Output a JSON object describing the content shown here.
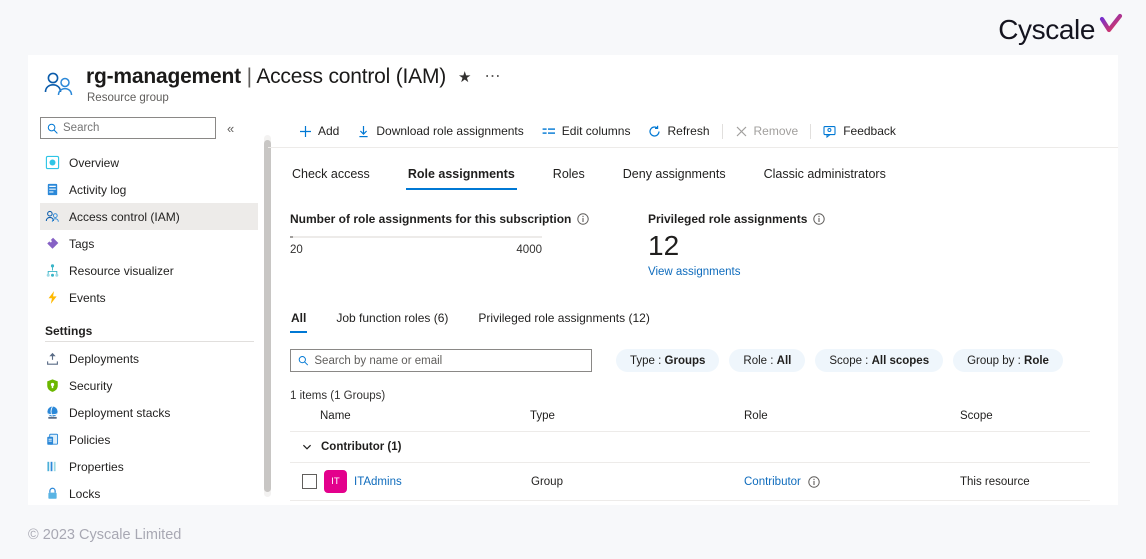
{
  "brand": {
    "name": "Cyscale",
    "check_icon": "check-mark-icon"
  },
  "header": {
    "resource_name": "rg-management",
    "separator": "|",
    "section": "Access control (IAM)",
    "subtitle": "Resource group",
    "favorite_icon": "star-icon",
    "more_icon": "ellipsis-icon",
    "resource_icon": "resource-group-people-icon"
  },
  "sidebar": {
    "search": {
      "placeholder": "Search",
      "value": "",
      "icon": "search-icon"
    },
    "collapse_icon": "chevron-double-left-icon",
    "items": [
      {
        "label": "Overview",
        "icon": "overview-icon",
        "selected": false
      },
      {
        "label": "Activity log",
        "icon": "activity-log-icon",
        "selected": false
      },
      {
        "label": "Access control (IAM)",
        "icon": "access-control-icon",
        "selected": true
      },
      {
        "label": "Tags",
        "icon": "tags-icon",
        "selected": false
      },
      {
        "label": "Resource visualizer",
        "icon": "resource-visualizer-icon",
        "selected": false
      },
      {
        "label": "Events",
        "icon": "events-icon",
        "selected": false
      }
    ],
    "settings_group_title": "Settings",
    "settings_items": [
      {
        "label": "Deployments",
        "icon": "deployments-icon"
      },
      {
        "label": "Security",
        "icon": "security-shield-icon"
      },
      {
        "label": "Deployment stacks",
        "icon": "deployment-stacks-icon"
      },
      {
        "label": "Policies",
        "icon": "policies-icon"
      },
      {
        "label": "Properties",
        "icon": "properties-icon"
      },
      {
        "label": "Locks",
        "icon": "lock-icon"
      }
    ]
  },
  "toolbar": {
    "add_label": "Add",
    "download_label": "Download role assignments",
    "edit_columns_label": "Edit columns",
    "refresh_label": "Refresh",
    "remove_label": "Remove",
    "feedback_label": "Feedback"
  },
  "tabs": [
    {
      "label": "Check access",
      "active": false
    },
    {
      "label": "Role assignments",
      "active": true
    },
    {
      "label": "Roles",
      "active": false
    },
    {
      "label": "Deny assignments",
      "active": false
    },
    {
      "label": "Classic administrators",
      "active": false
    }
  ],
  "metrics": {
    "assignments": {
      "label": "Number of role assignments for this subscription",
      "current": "20",
      "max": "4000",
      "info_icon": "info-icon"
    },
    "privileged": {
      "label": "Privileged role assignments",
      "count": "12",
      "link_label": "View assignments",
      "info_icon": "info-icon"
    }
  },
  "subtabs": [
    {
      "label": "All",
      "active": true
    },
    {
      "label": "Job function roles (6)",
      "active": false
    },
    {
      "label": "Privileged role assignments (12)",
      "active": false
    }
  ],
  "filters": {
    "search": {
      "placeholder": "Search by name or email",
      "value": "",
      "icon": "search-icon"
    },
    "pills": [
      {
        "key": "Type :",
        "value": "Groups"
      },
      {
        "key": "Role :",
        "value": "All"
      },
      {
        "key": "Scope :",
        "value": "All scopes"
      },
      {
        "key": "Group by :",
        "value": "Role"
      }
    ]
  },
  "table": {
    "count_text": "1 items (1 Groups)",
    "columns": [
      "Name",
      "Type",
      "Role",
      "Scope"
    ],
    "groups": [
      {
        "label": "Contributor (1)",
        "chevron_icon": "chevron-down-icon",
        "rows": [
          {
            "avatar_initials": "IT",
            "avatar_color": "#e3008c",
            "name": "ITAdmins",
            "type": "Group",
            "role": "Contributor",
            "role_info_icon": "info-icon",
            "scope": "This resource"
          }
        ]
      }
    ]
  },
  "footer": {
    "copyright": "© 2023 Cyscale Limited"
  }
}
